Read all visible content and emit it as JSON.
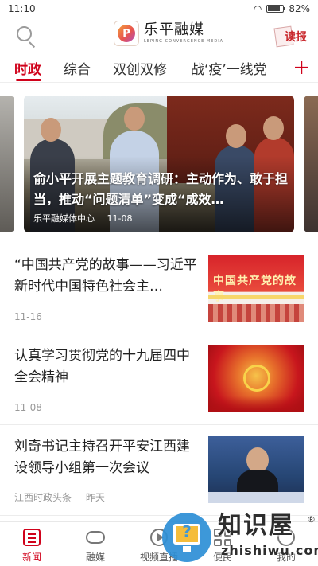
{
  "status_bar": {
    "time": "11:10",
    "battery": "82%",
    "battery_level": 0.82
  },
  "header": {
    "logo_initial": "P",
    "logo_cn": "乐平融媒",
    "logo_en": "LEPING CONVERGENCE MEDIA",
    "report_label": "读报"
  },
  "tabs": [
    {
      "label": "时政",
      "active": true
    },
    {
      "label": "综合",
      "active": false
    },
    {
      "label": "双创双修",
      "active": false
    },
    {
      "label": "战‘疫’一线党",
      "active": false
    }
  ],
  "tab_add_label": "+",
  "banner": {
    "title": "俞小平开展主题教育调研：主动作为、敢于担当，推动“问题清单”变成“成效…",
    "source": "乐平融媒体中心",
    "date": "11-08"
  },
  "news": [
    {
      "title": "“中国共产党的故事——习近平新时代中国特色社会主…",
      "source": "",
      "date": "11-16",
      "thumb_text": "中国共产党的故事"
    },
    {
      "title": "认真学习贯彻党的十九届四中全会精神",
      "source": "",
      "date": "11-08"
    },
    {
      "title": "刘奇书记主持召开平安江西建设领导小组第一次会议",
      "source": "江西时政头条",
      "date": "昨天"
    }
  ],
  "bottom_nav": [
    {
      "label": "新闻",
      "icon": "news-icon",
      "active": true
    },
    {
      "label": "融媒",
      "icon": "cloud-icon",
      "active": false
    },
    {
      "label": "视频直播",
      "icon": "video-icon",
      "active": false
    },
    {
      "label": "便民",
      "icon": "grid-icon",
      "active": false
    },
    {
      "label": "我的",
      "icon": "user-icon",
      "active": false
    }
  ],
  "watermark": {
    "cn": "知识屋",
    "reg": "®",
    "en": "zhishiwu.com"
  },
  "colors": {
    "accent": "#d0021b",
    "watermark_blue": "#2d8fd6"
  }
}
